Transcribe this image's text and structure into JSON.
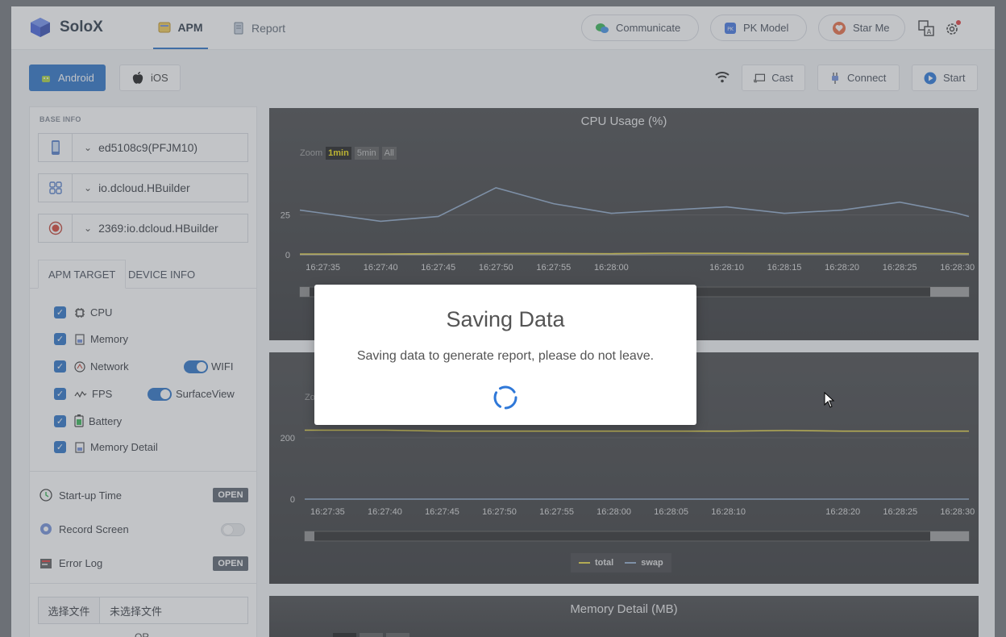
{
  "header": {
    "app_name": "SoloX",
    "tabs": [
      {
        "label": "APM",
        "active": true
      },
      {
        "label": "Report",
        "active": false
      }
    ],
    "actions": [
      {
        "label": "Communicate",
        "icon": "chat-icon"
      },
      {
        "label": "PK Model",
        "icon": "pk-icon"
      },
      {
        "label": "Star Me",
        "icon": "heart-icon"
      }
    ],
    "icons": [
      "translate-icon",
      "settings-icon"
    ]
  },
  "platform": {
    "android_label": "Android",
    "ios_label": "iOS",
    "active": "Android"
  },
  "toolbar": {
    "cast_label": "Cast",
    "connect_label": "Connect",
    "start_label": "Start"
  },
  "sidebar": {
    "section_label": "BASE INFO",
    "device": "ed5108c9(PFJM10)",
    "package": "io.dcloud.HBuilder",
    "process": "2369:io.dcloud.HBuilder",
    "tabs": [
      {
        "label": "APM TARGET",
        "active": true
      },
      {
        "label": "DEVICE INFO",
        "active": false
      }
    ],
    "targets": [
      {
        "label": "CPU",
        "checked": true,
        "icon": "cpu-icon"
      },
      {
        "label": "Memory",
        "checked": true,
        "icon": "memory-icon"
      },
      {
        "label": "Network",
        "checked": true,
        "icon": "network-icon"
      },
      {
        "label": "FPS",
        "checked": true,
        "icon": "fps-icon"
      },
      {
        "label": "Battery",
        "checked": true,
        "icon": "battery-icon"
      },
      {
        "label": "Memory Detail",
        "checked": true,
        "icon": "memory-detail-icon"
      }
    ],
    "wifi_toggle": {
      "label": "WIFI",
      "on": true
    },
    "surface_toggle": {
      "label": "SurfaceView",
      "on": true
    },
    "tools": [
      {
        "label": "Start-up Time",
        "badge": "OPEN"
      },
      {
        "label": "Record Screen",
        "toggle_on": false
      },
      {
        "label": "Error Log",
        "badge": "OPEN"
      }
    ],
    "file_button": "选择文件",
    "file_name": "未选择文件",
    "or_text": "OR"
  },
  "charts": [
    {
      "title": "CPU Usage (%)",
      "zoom": {
        "label": "Zoom",
        "options": [
          "1min",
          "5min",
          "All"
        ],
        "selected": "1min"
      },
      "x_ticks": [
        "16:27:35",
        "16:27:40",
        "16:27:45",
        "16:27:50",
        "16:27:55",
        "16:28:00",
        "16:28:10",
        "16:28:15",
        "16:28:20",
        "16:28:25",
        "16:28:30"
      ],
      "y_ticks": [
        "25",
        "0"
      ]
    },
    {
      "title": "",
      "zoom_label": "Zo",
      "x_ticks": [
        "16:27:35",
        "16:27:40",
        "16:27:45",
        "16:27:50",
        "16:27:55",
        "16:28:00",
        "16:28:05",
        "16:28:10",
        "16:28:20",
        "16:28:25",
        "16:28:30"
      ],
      "y_ticks": [
        "200",
        "0"
      ],
      "legend": [
        {
          "name": "total",
          "color": "#e6d33a"
        },
        {
          "name": "swap",
          "color": "#8aa6c8"
        }
      ]
    },
    {
      "title": "Memory Detail (MB)"
    }
  ],
  "chart_data": [
    {
      "type": "line",
      "title": "CPU Usage (%)",
      "x": [
        "16:27:33",
        "16:27:35",
        "16:27:40",
        "16:27:45",
        "16:27:50",
        "16:27:55",
        "16:28:00",
        "16:28:05",
        "16:28:10",
        "16:28:15",
        "16:28:20",
        "16:28:25",
        "16:28:30",
        "16:28:31"
      ],
      "series": [
        {
          "values": [
            28,
            26,
            21,
            24,
            42,
            32,
            26,
            28,
            30,
            26,
            28,
            33,
            26,
            24
          ],
          "color": "#8aa6c8"
        },
        {
          "values": [
            0.5,
            0.5,
            0.5,
            0.7,
            0.8,
            0.8,
            0.7,
            1.0,
            0.9,
            0.8,
            0.8,
            0.8,
            0.8,
            0.7
          ],
          "color": "#e6d33a"
        }
      ],
      "ylim": [
        0,
        50
      ]
    },
    {
      "type": "line",
      "x": [
        "16:27:33",
        "16:27:35",
        "16:27:40",
        "16:27:45",
        "16:27:50",
        "16:27:55",
        "16:28:00",
        "16:28:05",
        "16:28:10",
        "16:28:15",
        "16:28:20",
        "16:28:25",
        "16:28:30",
        "16:28:31"
      ],
      "series": [
        {
          "name": "total",
          "values": [
            225,
            225,
            225,
            222,
            222,
            222,
            222,
            222,
            222,
            224,
            222,
            222,
            222,
            222
          ],
          "color": "#e6d33a"
        },
        {
          "name": "swap",
          "values": [
            0,
            0,
            0,
            0,
            0,
            0,
            0,
            0,
            0,
            0,
            0,
            0,
            0,
            0
          ],
          "color": "#8aa6c8"
        }
      ],
      "ylim": [
        0,
        400
      ]
    }
  ],
  "modal": {
    "title": "Saving Data",
    "message": "Saving data to generate report, please do not leave."
  }
}
